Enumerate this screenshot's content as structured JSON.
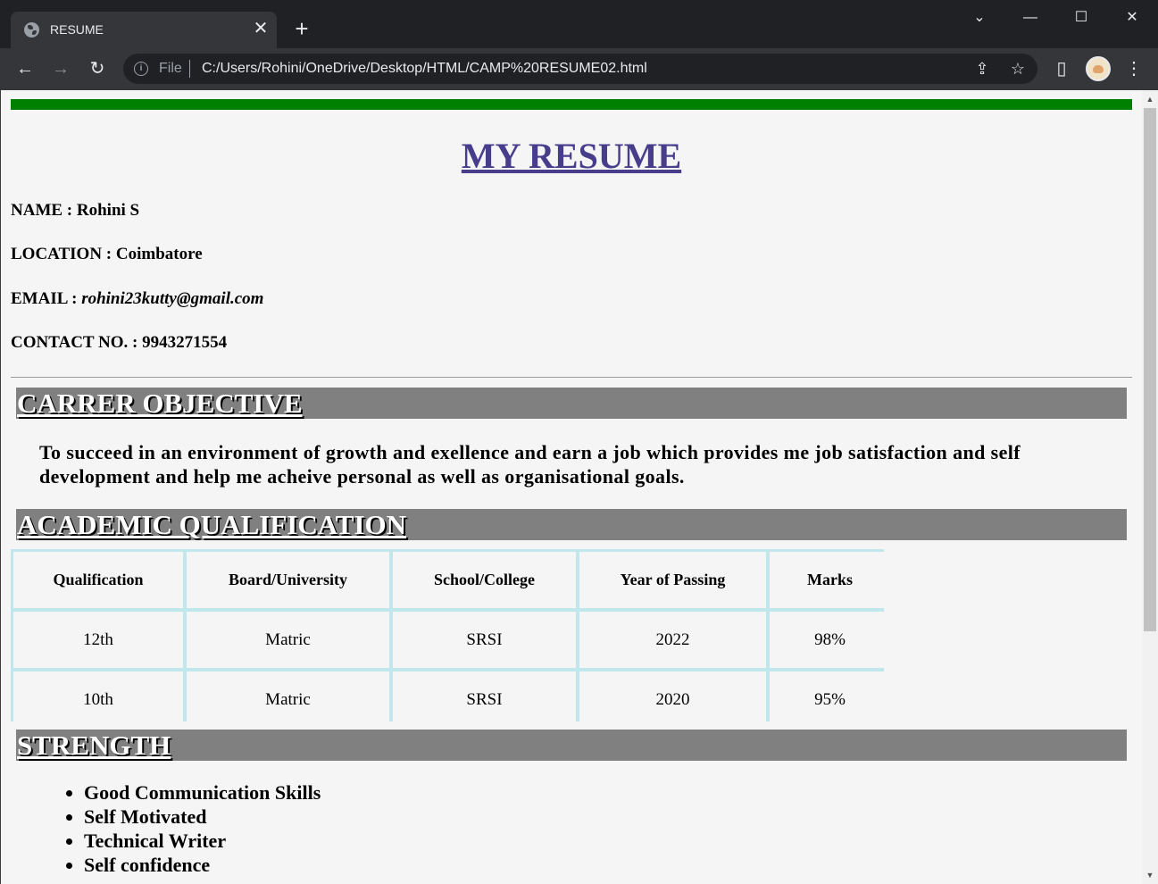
{
  "browser": {
    "tab_title": "RESUME",
    "tab_close": "✕",
    "new_tab": "+",
    "url_scheme": "File",
    "url": "C:/Users/Rohini/OneDrive/Desktop/HTML/CAMP%20RESUME02.html",
    "icons": {
      "back": "←",
      "forward": "→",
      "reload": "↻",
      "share": "⇪",
      "bookmark": "☆",
      "side_panel": "▯",
      "menu": "⋮",
      "tab_search": "⌄",
      "minimize": "—",
      "maximize": "☐",
      "close": "✕"
    }
  },
  "resume": {
    "title": "MY RESUME",
    "name_label": "NAME :",
    "name_value": "Rohini S",
    "location_label": "LOCATION :",
    "location_value": "Coimbatore",
    "email_label": "EMAIL :",
    "email_value": "rohini23kutty@gmail.com",
    "contact_label": "CONTACT NO. :",
    "contact_value": "9943271554",
    "objective_heading": "CARRER OBJECTIVE",
    "objective_text": "To succeed in an environment of growth and exellence and earn a job which provides me job satisfaction and self development and help me acheive personal as well as organisational goals.",
    "academic_heading": "ACADEMIC QUALIFICATION",
    "table": {
      "headers": [
        "Qualification",
        "Board/University",
        "School/College",
        "Year of Passing",
        "Marks"
      ],
      "rows": [
        [
          "12th",
          "Matric",
          "SRSI",
          "2022",
          "98%"
        ],
        [
          "10th",
          "Matric",
          "SRSI",
          "2020",
          "95%"
        ]
      ]
    },
    "strength_heading": "STRENGTH",
    "strengths": [
      "Good Communication Skills",
      "Self Motivated",
      "Technical Writer",
      "Self confidence"
    ]
  },
  "colors": {
    "green_rule": "#008000",
    "title": "#483d8b",
    "section_bar": "#808080",
    "table_border": "#c0e8ec"
  }
}
